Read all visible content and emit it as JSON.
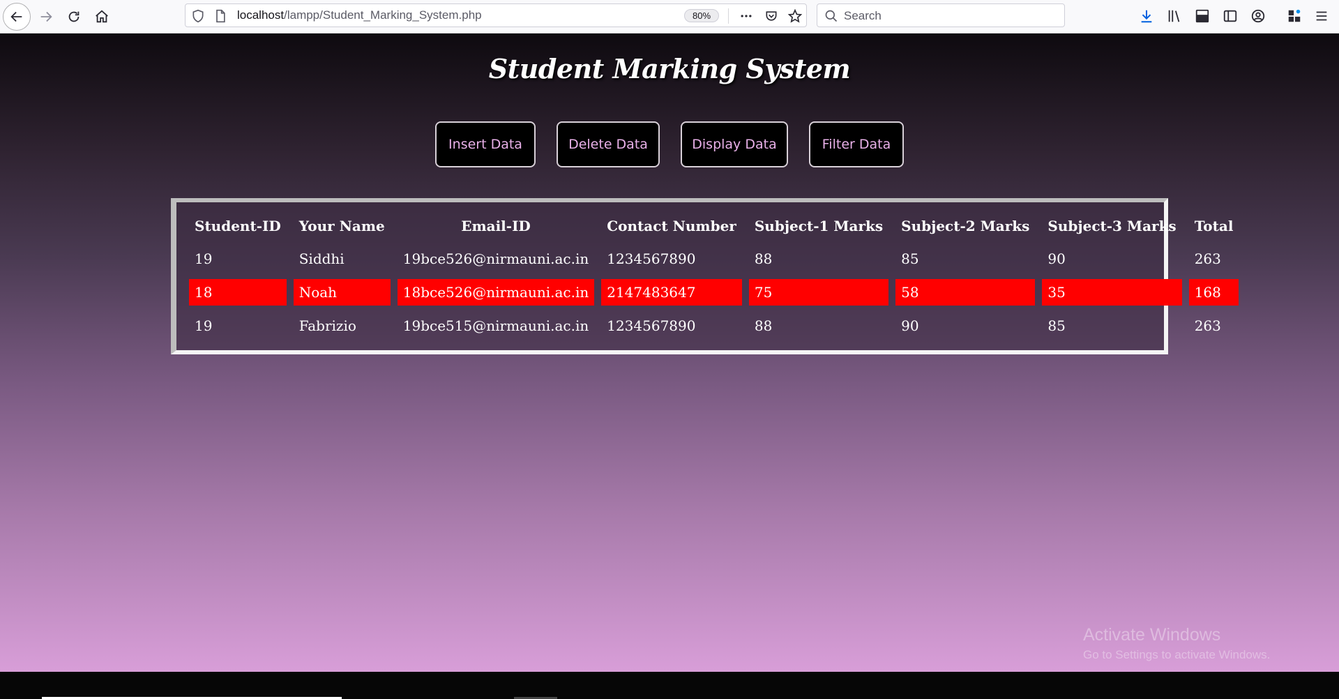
{
  "browser": {
    "url_host": "localhost",
    "url_path": "/lampp/Student_Marking_System.php",
    "zoom": "80%",
    "search_placeholder": "Search"
  },
  "page": {
    "title": "Student Marking System",
    "buttons": [
      "Insert Data",
      "Delete Data",
      "Display Data",
      "Filter Data"
    ]
  },
  "table": {
    "headers": [
      "Student-ID",
      "Your Name",
      "Email-ID",
      "Contact Number",
      "Subject-1 Marks",
      "Subject-2 Marks",
      "Subject-3 Marks",
      "Total"
    ],
    "rows": [
      [
        "19",
        "Siddhi",
        "19bce526@nirmauni.ac.in",
        "1234567890",
        "88",
        "85",
        "90",
        "263"
      ],
      [
        "18",
        "Noah",
        "18bce526@nirmauni.ac.in",
        "2147483647",
        "75",
        "58",
        "35",
        "168"
      ],
      [
        "19",
        "Fabrizio",
        "19bce515@nirmauni.ac.in",
        "1234567890",
        "88",
        "90",
        "85",
        "263"
      ]
    ],
    "highlight_color": "#ff0000"
  },
  "watermark": {
    "line1": "Activate Windows",
    "line2": "Go to Settings to activate Windows."
  }
}
